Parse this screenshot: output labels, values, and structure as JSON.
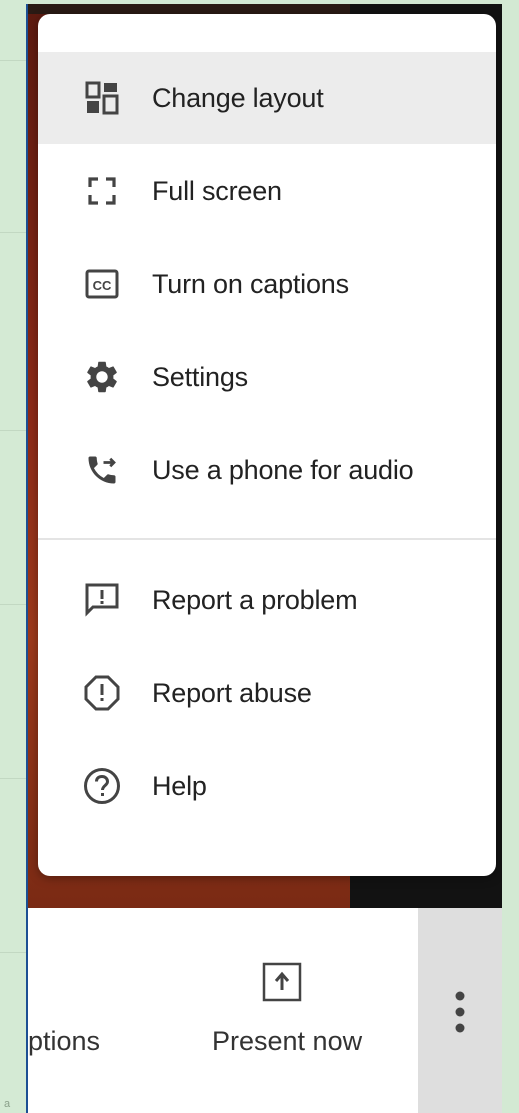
{
  "menu": {
    "items": [
      {
        "label": "Change layout",
        "icon": "change-layout-icon"
      },
      {
        "label": "Full screen",
        "icon": "full-screen-icon"
      },
      {
        "label": "Turn on captions",
        "icon": "captions-icon"
      },
      {
        "label": "Settings",
        "icon": "gear-icon"
      },
      {
        "label": "Use a phone for audio",
        "icon": "phone-audio-icon"
      },
      {
        "label": "Report a problem",
        "icon": "report-problem-icon"
      },
      {
        "label": "Report abuse",
        "icon": "report-abuse-icon"
      },
      {
        "label": "Help",
        "icon": "help-icon"
      }
    ]
  },
  "toolbar": {
    "captions_label": "ptions",
    "present_label": "Present now",
    "more_icon": "more-vert-icon"
  },
  "colors": {
    "menu_bg": "#ffffff",
    "active_item_bg": "#ececec",
    "icon_color": "#444444",
    "text_color": "#222222",
    "page_bg": "#d3e9d3",
    "frame_border": "#1c4f93"
  }
}
